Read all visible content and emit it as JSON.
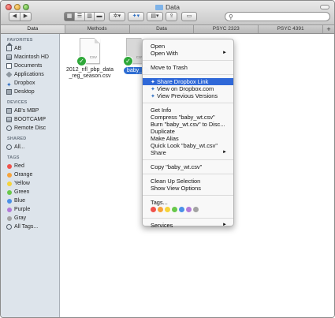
{
  "window": {
    "title": "Data"
  },
  "toolbar": {
    "back_icon": "chevron-left-icon",
    "forward_icon": "chevron-right-icon",
    "view_modes": [
      "icon-view",
      "list-view",
      "column-view",
      "cover-flow-view"
    ],
    "action_icon": "gear-icon",
    "dropbox_icon": "dropbox-icon",
    "arrange_icon": "arrange-icon",
    "share_icon": "share-icon",
    "tag_icon": "tag-icon",
    "search_placeholder": ""
  },
  "tabs": [
    "Data",
    "Methods",
    "Data",
    "PSYC 2323",
    "PSYC 4391"
  ],
  "sidebar": {
    "favorites_heading": "FAVORITES",
    "favorites": [
      "AB",
      "Macintosh HD",
      "Documents",
      "Applications",
      "Dropbox",
      "Desktop"
    ],
    "devices_heading": "DEVICES",
    "devices": [
      "AB's MBP",
      "BOOTCAMP",
      "Remote Disc"
    ],
    "shared_heading": "SHARED",
    "shared": [
      "All..."
    ],
    "tags_heading": "TAGS",
    "tags": [
      {
        "label": "Red",
        "color": "#f0524b"
      },
      {
        "label": "Orange",
        "color": "#f7a33b"
      },
      {
        "label": "Yellow",
        "color": "#f6d43a"
      },
      {
        "label": "Green",
        "color": "#68c84a"
      },
      {
        "label": "Blue",
        "color": "#4a90e8"
      },
      {
        "label": "Purple",
        "color": "#b27ad8"
      },
      {
        "label": "Gray",
        "color": "#a3a3a3"
      },
      {
        "label": "All Tags...",
        "color": ""
      }
    ]
  },
  "files": [
    {
      "name_line1": "2012_nfl_pbp_data",
      "name_line2": "_reg_season.csv",
      "ext": "CSV",
      "selected": false
    },
    {
      "name_line1": "baby_w",
      "name_line2": "",
      "ext": "CSV",
      "selected": true
    }
  ],
  "context_menu": {
    "open": "Open",
    "open_with": "Open With",
    "move_to_trash": "Move to Trash",
    "share_dropbox_link": "Share Dropbox Link",
    "view_on_dropbox": "View on Dropbox.com",
    "view_previous_versions": "View Previous Versions",
    "get_info": "Get Info",
    "compress": "Compress \"baby_wt.csv\"",
    "burn": "Burn \"baby_wt.csv\" to Disc...",
    "duplicate": "Duplicate",
    "make_alias": "Make Alias",
    "quick_look": "Quick Look \"baby_wt.csv\"",
    "share": "Share",
    "copy": "Copy \"baby_wt.csv\"",
    "clean_up": "Clean Up Selection",
    "show_view_options": "Show View Options",
    "tags": "Tags...",
    "tag_colors": [
      "#f0524b",
      "#f7a33b",
      "#f6d43a",
      "#68c84a",
      "#4a90e8",
      "#b27ad8",
      "#a3a3a3"
    ],
    "services": "Services",
    "submenu_arrow": "►"
  }
}
